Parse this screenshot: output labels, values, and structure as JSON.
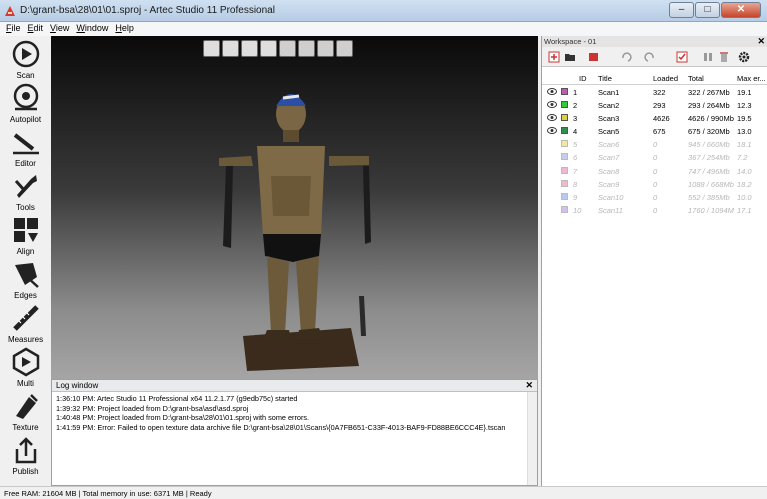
{
  "window": {
    "title": "D:\\grant-bsa\\28\\01\\01.sproj - Artec Studio 11 Professional",
    "min": "–",
    "max": "□",
    "close": "✕"
  },
  "menu": [
    {
      "first": "F",
      "rest": "ile"
    },
    {
      "first": "E",
      "rest": "dit"
    },
    {
      "first": "V",
      "rest": "iew"
    },
    {
      "first": "W",
      "rest": "indow"
    },
    {
      "first": "H",
      "rest": "elp"
    }
  ],
  "tools": [
    {
      "label": "Scan",
      "icon": "scan-icon"
    },
    {
      "label": "Autopilot",
      "icon": "autopilot-icon"
    },
    {
      "label": "Editor",
      "icon": "editor-icon"
    },
    {
      "label": "Tools",
      "icon": "tools-icon"
    },
    {
      "label": "Align",
      "icon": "align-icon"
    },
    {
      "label": "Edges",
      "icon": "edges-icon"
    },
    {
      "label": "Measures",
      "icon": "measures-icon"
    },
    {
      "label": "Multi",
      "icon": "multi-icon"
    },
    {
      "label": "Texture",
      "icon": "texture-icon"
    },
    {
      "label": "Publish",
      "icon": "publish-icon"
    }
  ],
  "log": {
    "title": "Log window",
    "close": "✕",
    "lines": [
      "1:36:10 PM: Artec Studio 11 Professional x64 11.2.1.77 (g9edb75c) started",
      "1:39:32 PM: Project loaded from D:\\grant-bsa\\asd\\asd.sproj",
      "1:40:48 PM: Project loaded from D:\\grant-bsa\\28\\01\\01.sproj with some errors.",
      "1:41:59 PM: Error: Failed to open texture data archive file D:\\grant-bsa\\28\\01\\Scans\\{0A7FB651-C33F-4013-BAF9-FD88BE6CCC4E}.tscan"
    ]
  },
  "workspace": {
    "title": "Workspace - 01",
    "close": "✕",
    "columns": {
      "id": "ID",
      "title": "Title",
      "loaded": "Loaded",
      "total": "Total",
      "maxerr": "Max er..."
    },
    "rows": [
      {
        "id": "1",
        "title": "Scan1",
        "loaded": "322",
        "total": "322 / 267Mb",
        "maxerr": "19.1",
        "color": "#c15ab0",
        "visible": true
      },
      {
        "id": "2",
        "title": "Scan2",
        "loaded": "293",
        "total": "293 / 264Mb",
        "maxerr": "12.3",
        "color": "#35c83a",
        "visible": true
      },
      {
        "id": "3",
        "title": "Scan3",
        "loaded": "4626",
        "total": "4626 / 990Mb",
        "maxerr": "19.5",
        "color": "#e0cf3a",
        "visible": true
      },
      {
        "id": "4",
        "title": "Scan5",
        "loaded": "675",
        "total": "675 / 320Mb",
        "maxerr": "13.0",
        "color": "#2f8f52",
        "visible": true
      },
      {
        "id": "5",
        "title": "Scan6",
        "loaded": "0",
        "total": "945 / 660Mb",
        "maxerr": "18.1",
        "color": "#f1e89a",
        "visible": false
      },
      {
        "id": "6",
        "title": "Scan7",
        "loaded": "0",
        "total": "367 / 254Mb",
        "maxerr": "7.2",
        "color": "#c8cde8",
        "visible": false
      },
      {
        "id": "7",
        "title": "Scan8",
        "loaded": "0",
        "total": "747 / 496Mb",
        "maxerr": "14.0",
        "color": "#f0b8d0",
        "visible": false
      },
      {
        "id": "8",
        "title": "Scan9",
        "loaded": "0",
        "total": "1088 / 668Mb",
        "maxerr": "18.2",
        "color": "#f0b8d0",
        "visible": false
      },
      {
        "id": "9",
        "title": "Scan10",
        "loaded": "0",
        "total": "552 / 385Mb",
        "maxerr": "10.0",
        "color": "#b8c8ee",
        "visible": false
      },
      {
        "id": "10",
        "title": "Scan11",
        "loaded": "0",
        "total": "1760 / 1094M",
        "maxerr": "17.1",
        "color": "#d2c0ee",
        "visible": false
      }
    ]
  },
  "status": "Free RAM: 21604 MB  |  Total memory in use: 6371 MB  |   Ready"
}
